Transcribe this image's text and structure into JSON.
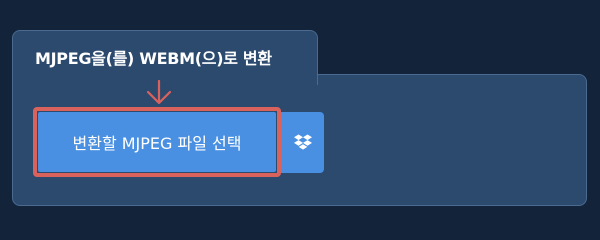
{
  "tab": {
    "title": "MJPEG을(를) WEBM(으)로 변환"
  },
  "upload": {
    "select_button_label": "변환할 MJPEG 파일 선택",
    "dropbox_icon": "dropbox-icon"
  },
  "colors": {
    "background": "#12233a",
    "panel": "#2c4a6e",
    "button": "#4a90e2",
    "highlight": "#d9625d"
  }
}
